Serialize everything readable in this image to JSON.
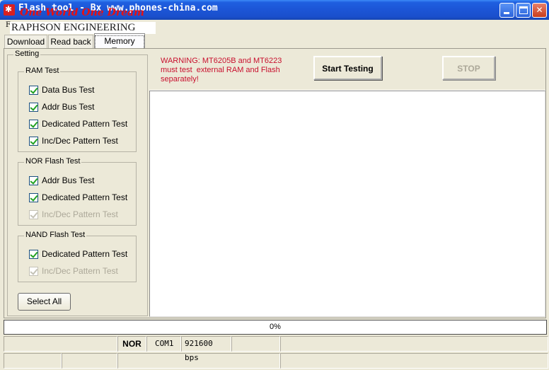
{
  "window": {
    "title": "Flash tool - Bx www.phones-china.com",
    "title_overlay": "One World One Dream",
    "icon": "app-icon",
    "controls": [
      "minimize-icon",
      "maximize-icon",
      "close-icon"
    ]
  },
  "menu": {
    "first_letter": "F"
  },
  "brand": {
    "text": "RAPHSON ENGINEERING"
  },
  "tabs": [
    {
      "label": "Download",
      "active": false
    },
    {
      "label": "Read back",
      "active": false
    },
    {
      "label": "Memory Test",
      "active": true
    }
  ],
  "setting": {
    "legend": "Setting",
    "groups": [
      {
        "legend": "RAM Test",
        "items": [
          {
            "label": "Data Bus Test",
            "checked": true,
            "enabled": true
          },
          {
            "label": "Addr Bus Test",
            "checked": true,
            "enabled": true
          },
          {
            "label": "Dedicated Pattern Test",
            "checked": true,
            "enabled": true
          },
          {
            "label": "Inc/Dec Pattern Test",
            "checked": true,
            "enabled": true
          }
        ]
      },
      {
        "legend": "NOR Flash Test",
        "items": [
          {
            "label": "Addr Bus Test",
            "checked": true,
            "enabled": true
          },
          {
            "label": "Dedicated Pattern Test",
            "checked": true,
            "enabled": true
          },
          {
            "label": "Inc/Dec Pattern Test",
            "checked": true,
            "enabled": false
          }
        ]
      },
      {
        "legend": "NAND Flash Test",
        "items": [
          {
            "label": "Dedicated Pattern Test",
            "checked": true,
            "enabled": true
          },
          {
            "label": "Inc/Dec Pattern Test",
            "checked": true,
            "enabled": false
          }
        ]
      }
    ],
    "select_all_label": "Select All"
  },
  "warning": {
    "line1": "WARNING: MT6205B and MT6223",
    "line2": "must test  external RAM and Flash",
    "line3": "separately!",
    "color": "#c8102e"
  },
  "actions": {
    "start_label": "Start Testing",
    "stop_label": "STOP"
  },
  "progress": {
    "percent": 0,
    "text": "0%"
  },
  "status": {
    "flash_type": "NOR",
    "port": "COM1",
    "baud": "921600 bps"
  }
}
